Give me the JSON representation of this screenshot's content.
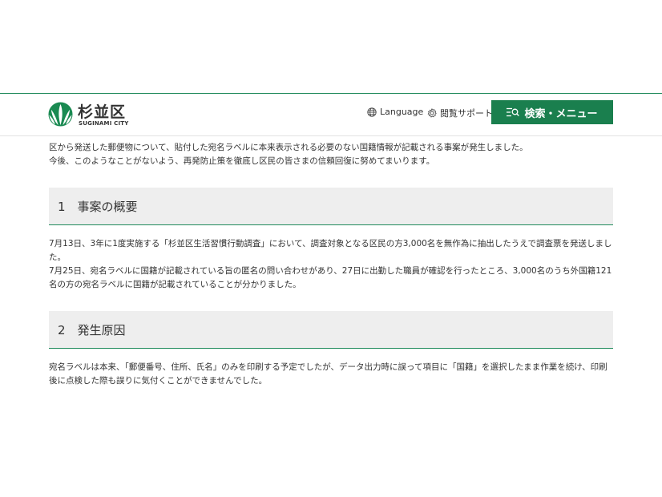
{
  "header": {
    "logo_name": "杉並区",
    "logo_sub": "SUGINAMI CITY",
    "language_label": "Language",
    "support_label": "閲覧サポート",
    "menu_label": "検索・メニュー"
  },
  "intro": {
    "line1": "区から発送した郵便物について、貼付した宛名ラベルに本来表示される必要のない国籍情報が記載される事案が発生しました。",
    "line2": "今後、このようなことがないよう、再発防止策を徹底し区民の皆さまの信頼回復に努めてまいります。"
  },
  "sections": [
    {
      "title": "1　事案の概要",
      "paragraphs": [
        "7月13日、3年に1度実施する「杉並区生活習慣行動調査」において、調査対象となる区民の方3,000名を無作為に抽出したうえで調査票を発送しました。",
        "7月25日、宛名ラベルに国籍が記載されている旨の匿名の問い合わせがあり、27日に出勤した職員が確認を行ったところ、3,000名のうち外国籍121名の方の宛名ラベルに国籍が記載されていることが分かりました。"
      ]
    },
    {
      "title": "2　発生原因",
      "paragraphs": [
        "宛名ラベルは本来、「郵便番号、住所、氏名」のみを印刷する予定でしたが、データ出力時に誤って項目に「国籍」を選択したまま作業を続け、印刷後に点検した際も誤りに気付くことができませんでした。"
      ]
    }
  ],
  "colors": {
    "brand_green": "#1a7f4e",
    "rule_green": "#1f8a5b",
    "section_bg": "#eeeeee"
  },
  "icons": {
    "logo": "suginami-logo-icon",
    "language": "globe-icon",
    "support": "gear-icon",
    "menu": "menu-search-icon"
  }
}
